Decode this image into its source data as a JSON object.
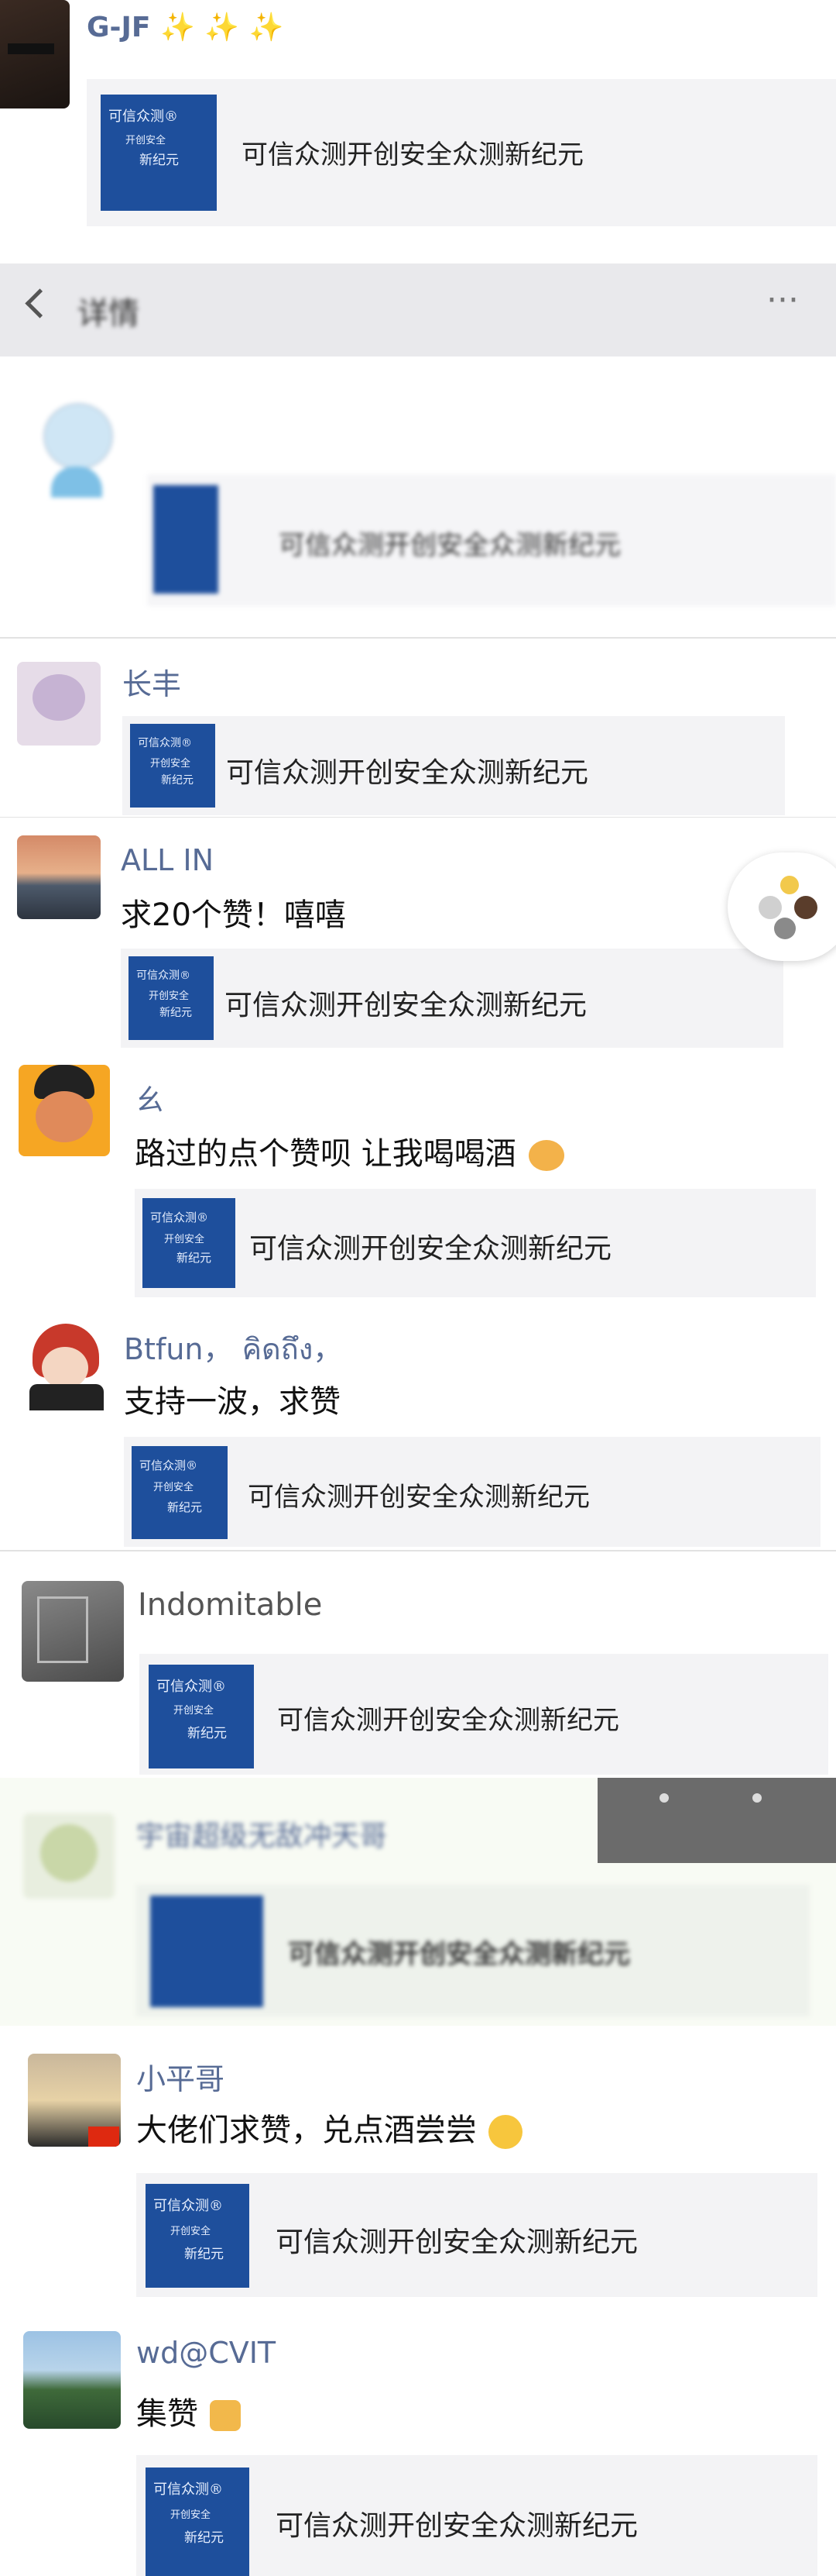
{
  "posts": [
    {
      "name": "G-JF",
      "sparkles": "✨ ✨ ✨",
      "card": "可信众测开创安全众测新纪元"
    },
    {
      "header_title": "详情",
      "header_more": "···",
      "card": "可信众测开创安全众测新纪元"
    },
    {
      "name": "长丰",
      "card": "可信众测开创安全众测新纪元"
    },
    {
      "name": "ALL IN",
      "text": "求20个赞！嘻嘻",
      "card": "可信众测开创安全众测新纪元"
    },
    {
      "name": "ㄠ",
      "text": "路过的点个赞呗 让我喝喝酒",
      "card": "可信众测开创安全众测新纪元"
    },
    {
      "name": "Btfun， คิดถึง，",
      "text": "支持一波，求赞",
      "card": "可信众测开创安全众测新纪元"
    },
    {
      "name": "Indomitable",
      "card": "可信众测开创安全众测新纪元"
    },
    {
      "name": "宇宙超级无敌冲天哥",
      "card": "可信众测开创安全众测新纪元"
    },
    {
      "name": "小平哥",
      "text": "大佬们求赞，兑点酒尝尝",
      "card": "可信众测开创安全众测新纪元"
    },
    {
      "name": "wd@CVIT",
      "text": "集赞",
      "card": "可信众测开创安全众测新纪元"
    }
  ],
  "thumb": {
    "line1": "可信众测®",
    "line2": "开创安全",
    "line3": "新纪元"
  },
  "colors": {
    "name": "#576b95",
    "card_bg": "#f3f3f5",
    "thumb": "#1e4f9c"
  }
}
